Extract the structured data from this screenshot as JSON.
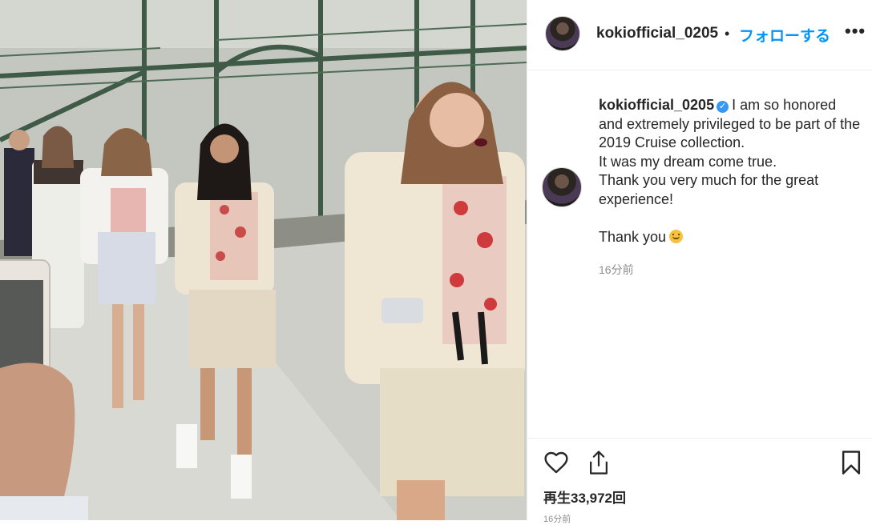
{
  "post": {
    "username": "kokiofficial_0205",
    "follow_label": "フォローする",
    "separator": "•",
    "more_label": "•••"
  },
  "caption": {
    "username": "kokiofficial_0205",
    "verified_mark": "✓",
    "lines": [
      "I am so honored and extremely privileged to be part of the 2019 Cruise collection.",
      "It was my dream come true.",
      "Thank you very much for the great experience!",
      "",
      "Thank you"
    ],
    "emoji": "smiling-face-emoji",
    "timestamp": "16分前"
  },
  "actions": {
    "like_icon": "heart-outline-icon",
    "share_icon": "share-upload-icon",
    "save_icon": "bookmark-outline-icon",
    "views": "再生33,972回",
    "time": "16分前"
  },
  "media": {
    "description_icon": "runway-video"
  },
  "colors": {
    "link_blue": "#0095f6",
    "verified_blue": "#3897f0",
    "text": "#262626",
    "muted": "#8e8e8e",
    "border": "#efefef"
  }
}
